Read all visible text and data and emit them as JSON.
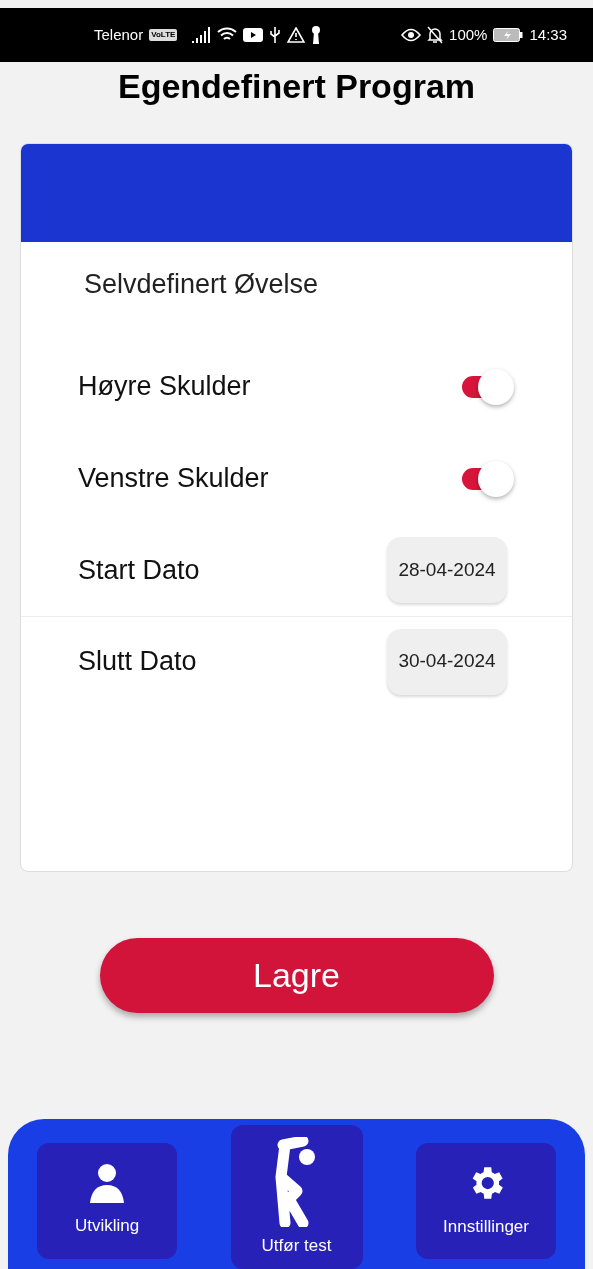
{
  "status_bar": {
    "carrier": "Telenor",
    "network_badge": "VoLTE",
    "battery": "100%",
    "time": "14:33"
  },
  "title": "Egendefinert Program",
  "card": {
    "heading": "Selvdefinert Øvelse",
    "switches": [
      {
        "label": "Høyre Skulder",
        "on": true
      },
      {
        "label": "Venstre Skulder",
        "on": true
      }
    ],
    "dates": [
      {
        "label": "Start Dato",
        "value": "28-04-2024"
      },
      {
        "label": "Slutt Dato",
        "value": "30-04-2024"
      }
    ]
  },
  "save_button": "Lagre",
  "nav": [
    {
      "label": "Utvikling",
      "kind": "person",
      "selected": false
    },
    {
      "label": "Utfør test",
      "kind": "exercise",
      "selected": true
    },
    {
      "label": "Innstillinger",
      "kind": "settings",
      "selected": false
    }
  ]
}
